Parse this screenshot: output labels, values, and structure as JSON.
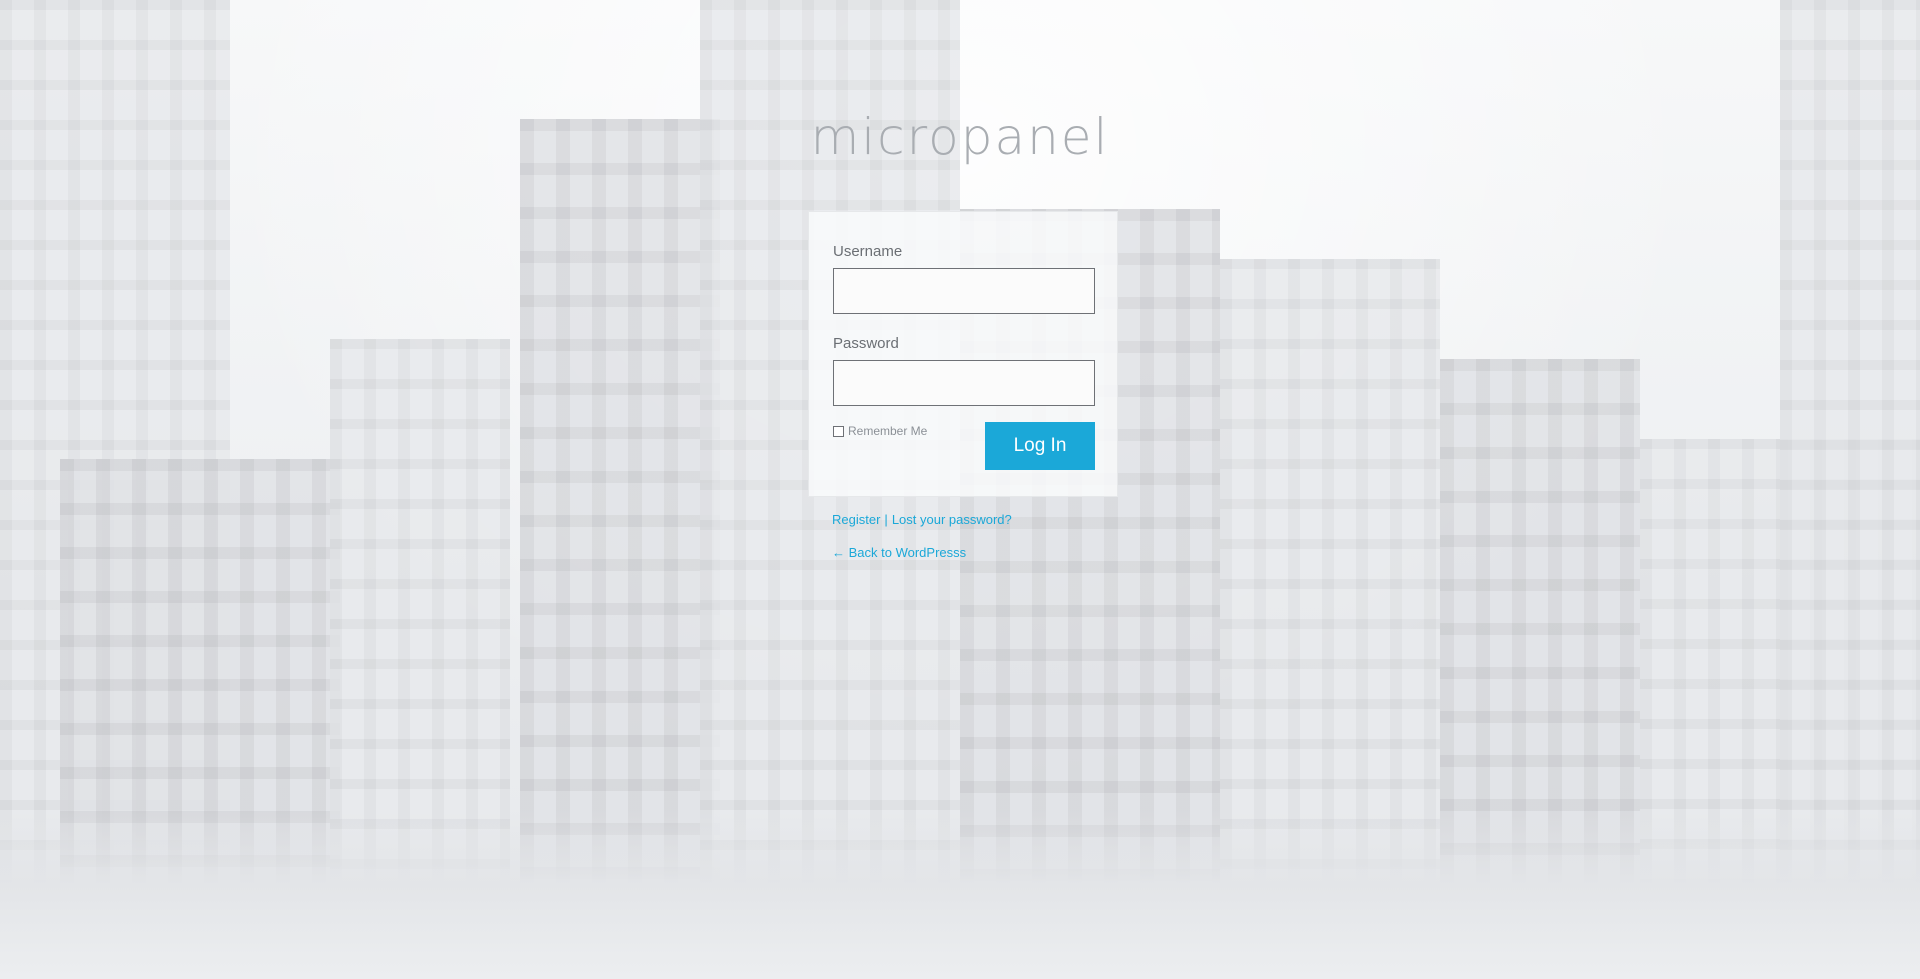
{
  "logo": {
    "text": "micropanel"
  },
  "form": {
    "username_label": "Username",
    "username_value": "",
    "password_label": "Password",
    "password_value": "",
    "remember_label": "Remember Me",
    "remember_checked": false,
    "submit_label": "Log In"
  },
  "links": {
    "register": "Register",
    "separator": "|",
    "lost_password": "Lost your password?",
    "back": "← Back to WordPresss"
  },
  "colors": {
    "accent": "#1ba8d8",
    "logo": "#a9adb2",
    "label": "#6b6f74"
  }
}
